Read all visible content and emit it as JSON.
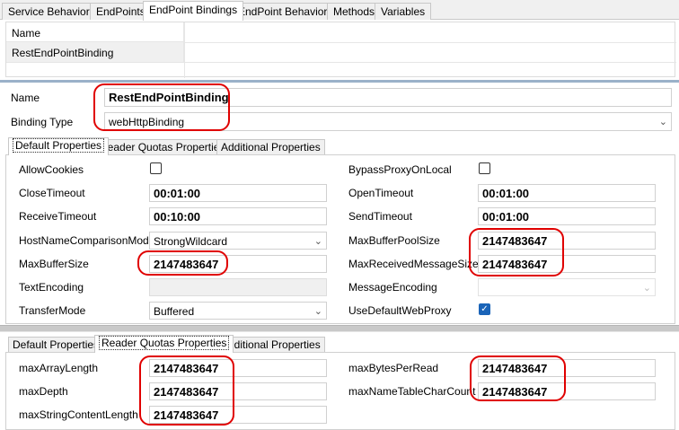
{
  "top_tabs": [
    {
      "label": "Service Behaviors"
    },
    {
      "label": "EndPoints"
    },
    {
      "label": "EndPoint Bindings"
    },
    {
      "label": "EndPoint Behaviors"
    },
    {
      "label": "Methods"
    },
    {
      "label": "Variables"
    }
  ],
  "list": {
    "header": "Name",
    "rows": [
      "RestEndPointBinding"
    ]
  },
  "binding": {
    "name_label": "Name",
    "name_value": "RestEndPointBinding",
    "type_label": "Binding Type",
    "type_value": "webHttpBinding"
  },
  "sub_tabs": [
    {
      "label": "Default Properties"
    },
    {
      "label": "Reader Quotas Properties"
    },
    {
      "label": "Additional Properties"
    }
  ],
  "default_props": {
    "allow_cookies": {
      "label": "AllowCookies",
      "checked": false
    },
    "bypass_proxy": {
      "label": "BypassProxyOnLocal",
      "checked": false
    },
    "close_timeout": {
      "label": "CloseTimeout",
      "value": "00:01:00"
    },
    "open_timeout": {
      "label": "OpenTimeout",
      "value": "00:01:00"
    },
    "receive_timeout": {
      "label": "ReceiveTimeout",
      "value": "00:10:00"
    },
    "send_timeout": {
      "label": "SendTimeout",
      "value": "00:01:00"
    },
    "hostname_mode": {
      "label": "HostNameComparisonMode",
      "value": "StrongWildcard"
    },
    "max_buffer_pool": {
      "label": "MaxBufferPoolSize",
      "value": "2147483647"
    },
    "max_buffer": {
      "label": "MaxBufferSize",
      "value": "2147483647"
    },
    "max_received": {
      "label": "MaxReceivedMessageSize",
      "value": "2147483647"
    },
    "text_encoding": {
      "label": "TextEncoding",
      "value": ""
    },
    "message_encoding": {
      "label": "MessageEncoding",
      "value": ""
    },
    "transfer_mode": {
      "label": "TransferMode",
      "value": "Buffered"
    },
    "use_default_proxy": {
      "label": "UseDefaultWebProxy",
      "checked": true
    }
  },
  "reader_quotas": {
    "max_array_length": {
      "label": "maxArrayLength",
      "value": "2147483647"
    },
    "max_bytes_per_read": {
      "label": "maxBytesPerRead",
      "value": "2147483647"
    },
    "max_depth": {
      "label": "maxDepth",
      "value": "2147483647"
    },
    "max_name_table": {
      "label": "maxNameTableCharCount",
      "value": "2147483647"
    },
    "max_string_content": {
      "label": "maxStringContentLength",
      "value": "2147483647"
    }
  },
  "icons": {
    "dropdown": "chevron-down-icon",
    "check": "checkmark-icon"
  },
  "colors": {
    "highlight": "#e00000",
    "checkbox_checked": "#1a64b8",
    "separator": "#9ab1c9"
  }
}
